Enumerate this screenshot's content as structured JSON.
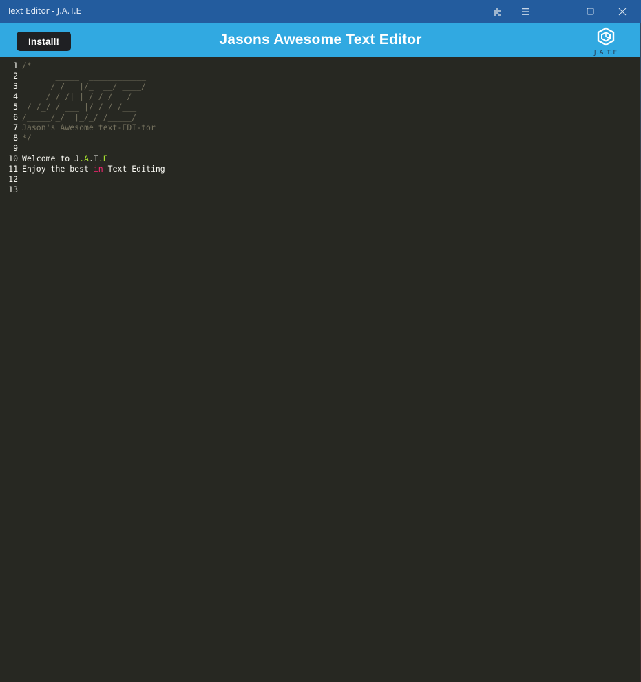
{
  "window": {
    "title": "Text Editor - J.A.T.E"
  },
  "header": {
    "install_label": "Install!",
    "title": "Jasons Awesome Text Editor",
    "logo_text": "J.A.T.E"
  },
  "editor": {
    "lines": [
      {
        "n": "1",
        "segments": [
          {
            "t": "/*",
            "c": "comment"
          }
        ]
      },
      {
        "n": "2",
        "segments": [
          {
            "t": "       _____  ____________",
            "c": "comment"
          }
        ]
      },
      {
        "n": "3",
        "segments": [
          {
            "t": "      / /   |/_  __/ ____/",
            "c": "comment"
          }
        ]
      },
      {
        "n": "4",
        "segments": [
          {
            "t": " __  / / /| | / / / __/",
            "c": "comment"
          }
        ]
      },
      {
        "n": "5",
        "segments": [
          {
            "t": " / /_/ / ___ |/ / / /___",
            "c": "comment"
          }
        ]
      },
      {
        "n": "6",
        "segments": [
          {
            "t": "/_____/_/  |_/_/ /_____/",
            "c": "comment"
          }
        ]
      },
      {
        "n": "7",
        "segments": [
          {
            "t": "Jason's Awesome text-EDI-tor",
            "c": "comment"
          }
        ]
      },
      {
        "n": "8",
        "segments": [
          {
            "t": "*/",
            "c": "comment"
          }
        ]
      },
      {
        "n": "9",
        "segments": []
      },
      {
        "n": "10",
        "segments": [
          {
            "t": "Welcome to J",
            "c": "plain"
          },
          {
            "t": ".A",
            "c": "green"
          },
          {
            "t": ".T",
            "c": "plain"
          },
          {
            "t": ".E",
            "c": "green"
          }
        ]
      },
      {
        "n": "11",
        "segments": [
          {
            "t": "Enjoy the best ",
            "c": "plain"
          },
          {
            "t": "in",
            "c": "keyword"
          },
          {
            "t": " Text Editing",
            "c": "plain"
          }
        ]
      },
      {
        "n": "12",
        "segments": []
      },
      {
        "n": "13",
        "segments": []
      }
    ]
  },
  "colors": {
    "titlebar": "#235c9e",
    "header": "#31a9e1",
    "editor_bg": "#272822",
    "comment": "#75715e",
    "plain": "#f8f8f2",
    "keyword": "#f92672",
    "green": "#a6e22e"
  },
  "icons": [
    "extensions-icon",
    "menu-icon",
    "maximize-icon",
    "close-icon",
    "jate-logo-icon"
  ]
}
